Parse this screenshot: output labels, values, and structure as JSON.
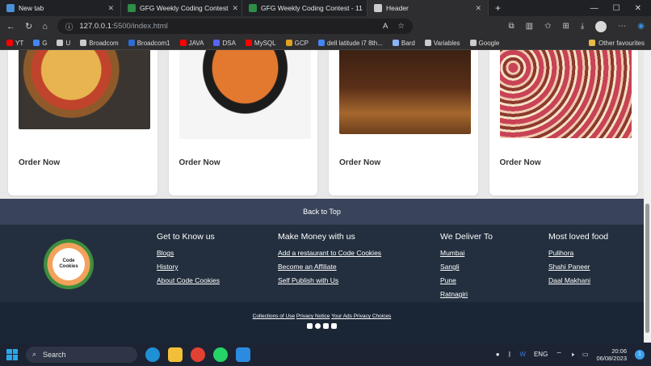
{
  "browser": {
    "tabs": [
      {
        "label": "New tab",
        "icon": "edge-tab-icon",
        "color": "#4a90d9"
      },
      {
        "label": "GFG Weekly Coding Contest",
        "icon": "gfg-icon",
        "color": "#2f8d46"
      },
      {
        "label": "GFG Weekly Coding Contest - 11",
        "icon": "gfg-icon",
        "color": "#2f8d46"
      },
      {
        "label": "Header",
        "icon": "page-icon",
        "color": "#cccccc",
        "active": true
      }
    ],
    "url_host": "127.0.0.1",
    "url_path": ":5500/index.html",
    "bookmarks": [
      {
        "label": "YT",
        "color": "#ff0000"
      },
      {
        "label": "G",
        "color": "#4285f4"
      },
      {
        "label": "U",
        "color": "#cccccc"
      },
      {
        "label": "Broadcom",
        "color": "#cccccc"
      },
      {
        "label": "Broadcom1",
        "color": "#2c6cd6"
      },
      {
        "label": "JAVA",
        "color": "#ff0000"
      },
      {
        "label": "DSA",
        "color": "#5865f2"
      },
      {
        "label": "MySQL",
        "color": "#ff0000"
      },
      {
        "label": "GCP",
        "color": "#e0a020"
      },
      {
        "label": "dell latitude i7 8th...",
        "color": "#4285f4"
      },
      {
        "label": "Bard",
        "color": "#8ab4f8"
      },
      {
        "label": "Variables",
        "color": "#cccccc"
      },
      {
        "label": "Google",
        "color": "#cccccc"
      }
    ],
    "other_favourites": "Other favourites"
  },
  "cards": [
    {
      "image": "pizza-image",
      "button": "Order Now"
    },
    {
      "image": "curry-image",
      "button": "Order Now"
    },
    {
      "image": "cake-image",
      "button": "Order Now"
    },
    {
      "image": "cupcakes-image",
      "button": "Order Now"
    }
  ],
  "back_to_top": "Back to Top",
  "logo": {
    "line1": "Code",
    "line2": "Cookies"
  },
  "footer": {
    "columns": [
      {
        "title": "Get to Know us",
        "links": [
          "Blogs",
          "History",
          "About Code Cookies"
        ]
      },
      {
        "title": "Make Money with us",
        "links": [
          "Add a restaurant to Code Cookies",
          "Become an Affiliate",
          "Self Publish with Us"
        ]
      },
      {
        "title": "We Deliver To",
        "links": [
          "Mumbai",
          "Sangli",
          "Pune",
          "Ratnagiri"
        ]
      },
      {
        "title": "Most loved food",
        "links": [
          "Pulihora",
          "Shahi Paneer",
          "Daal Makhani"
        ]
      }
    ],
    "legal": [
      "Collections of Use",
      "Privacy Notice",
      "Your Ads Privacy Choices"
    ],
    "socials": [
      "instagram-icon",
      "facebook-icon",
      "twitter-icon",
      "linkedin-icon"
    ]
  },
  "taskbar": {
    "search_label": "Search",
    "apps": [
      {
        "name": "edge-icon",
        "color": "#1f8fd6"
      },
      {
        "name": "file-explorer-icon",
        "color": "#f2c038"
      },
      {
        "name": "chrome-icon",
        "color": "#e34133"
      },
      {
        "name": "whatsapp-icon",
        "color": "#25d366"
      },
      {
        "name": "vscode-icon",
        "color": "#2c8ae0"
      }
    ],
    "language": "ENG",
    "time": "20:06",
    "date": "06/08/2023",
    "notifications": "1"
  }
}
